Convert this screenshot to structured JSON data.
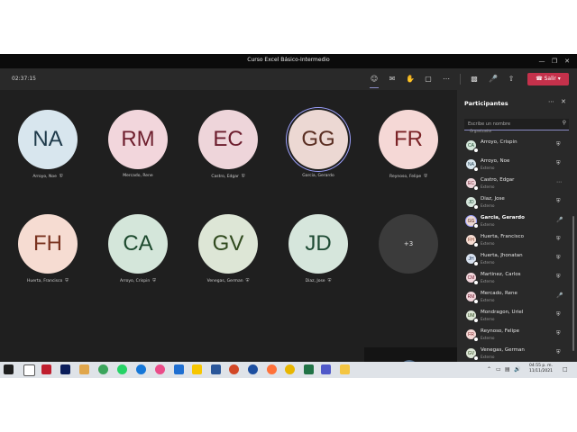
{
  "window": {
    "title": "Curso Excel Básico-Intermedio"
  },
  "toolbar": {
    "timer": "02:37:15",
    "leave_label": "Salir"
  },
  "grid": [
    {
      "initials": "NA",
      "name": "Arroyo, Noe",
      "bg": "#d8e6ee",
      "fg": "#1e3a4a",
      "muted": true
    },
    {
      "initials": "RM",
      "name": "Mercado, Rene",
      "bg": "#f2d6dc",
      "fg": "#6e1f2e",
      "muted": false
    },
    {
      "initials": "EC",
      "name": "Castro, Edgar",
      "bg": "#eed5da",
      "fg": "#6b1c2c",
      "muted": true
    },
    {
      "initials": "GG",
      "name": "Garcia, Gerardo",
      "bg": "#ecd8d3",
      "fg": "#5a2e22",
      "muted": false
    },
    {
      "initials": "FR",
      "name": "Reynoso, Felipe",
      "bg": "#f5d8d6",
      "fg": "#7a2226",
      "muted": true
    },
    {
      "initials": "FH",
      "name": "Huerta, Francisco",
      "bg": "#f6dcd2",
      "fg": "#7a3320",
      "muted": true
    },
    {
      "initials": "CA",
      "name": "Arroyo, Crispin",
      "bg": "#d4e6da",
      "fg": "#1d4a2e",
      "muted": true
    },
    {
      "initials": "GV",
      "name": "Venegas, German",
      "bg": "#dde6d6",
      "fg": "#304a1e",
      "muted": true
    },
    {
      "initials": "JD",
      "name": "Diaz, Jose",
      "bg": "#d6e6dc",
      "fg": "#1d4a33",
      "muted": true
    }
  ],
  "overflow": "+3",
  "panel": {
    "title": "Participantes",
    "search_placeholder": "Escribe un nombre",
    "organizer_label": "Organizador",
    "participants": [
      {
        "initials": "CA",
        "name": "Arroyo, Crispin",
        "role": "",
        "bg": "#d4e6da",
        "fg": "#1d4a2e",
        "mic": "muted",
        "bold": false
      },
      {
        "initials": "NA",
        "name": "Arroyo, Noe",
        "role": "Externo",
        "bg": "#d8e6ee",
        "fg": "#1e3a4a",
        "mic": "muted",
        "bold": false
      },
      {
        "initials": "EC",
        "name": "Castro, Edgar",
        "role": "Externo",
        "bg": "#eed5da",
        "fg": "#6b1c2c",
        "mic": "more",
        "bold": false
      },
      {
        "initials": "JD",
        "name": "Diaz, Jose",
        "role": "Externo",
        "bg": "#d6e6dc",
        "fg": "#1d4a33",
        "mic": "muted",
        "bold": false
      },
      {
        "initials": "GG",
        "name": "Garcia, Gerardo",
        "role": "Externo",
        "bg": "#ecd8d3",
        "fg": "#5a2e22",
        "mic": "on",
        "bold": true
      },
      {
        "initials": "FH",
        "name": "Huerta, Francisco",
        "role": "Externo",
        "bg": "#f6dcd2",
        "fg": "#7a3320",
        "mic": "muted",
        "bold": false
      },
      {
        "initials": "JH",
        "name": "Huerta, Jhonatan",
        "role": "Externo",
        "bg": "#d8e2f0",
        "fg": "#1e3558",
        "mic": "muted",
        "bold": false
      },
      {
        "initials": "CM",
        "name": "Martinez, Carlos",
        "role": "Externo",
        "bg": "#f2d6dc",
        "fg": "#6e1f2e",
        "mic": "muted",
        "bold": false
      },
      {
        "initials": "RM",
        "name": "Mercado, Rene",
        "role": "Externo",
        "bg": "#f2d6dc",
        "fg": "#6e1f2e",
        "mic": "on",
        "bold": false
      },
      {
        "initials": "UM",
        "name": "Mondragon, Uriel",
        "role": "Externo",
        "bg": "#dde6d6",
        "fg": "#304a1e",
        "mic": "muted",
        "bold": false
      },
      {
        "initials": "FR",
        "name": "Reynoso, Felipe",
        "role": "Externo",
        "bg": "#f5d8d6",
        "fg": "#7a2226",
        "mic": "muted",
        "bold": false
      },
      {
        "initials": "GV",
        "name": "Venegas, German",
        "role": "Externo",
        "bg": "#dde6d6",
        "fg": "#304a1e",
        "mic": "muted",
        "bold": false
      }
    ]
  },
  "taskbar": {
    "clock_time": "04:55 p. m.",
    "clock_date": "11/11/2021",
    "apps": [
      "start",
      "search",
      "word-doc",
      "filezilla",
      "photoshop",
      "files",
      "greenshot",
      "whatsapp",
      "edge",
      "itunes",
      "mail",
      "sticky",
      "word",
      "powerpoint",
      "firefox-dev",
      "firefox",
      "chrome",
      "excel",
      "teams",
      "explorer"
    ]
  },
  "colors": {
    "leave": "#c4314b",
    "accent": "#9ea2ff",
    "stage": "#1f1f1f",
    "panel": "#292929"
  }
}
